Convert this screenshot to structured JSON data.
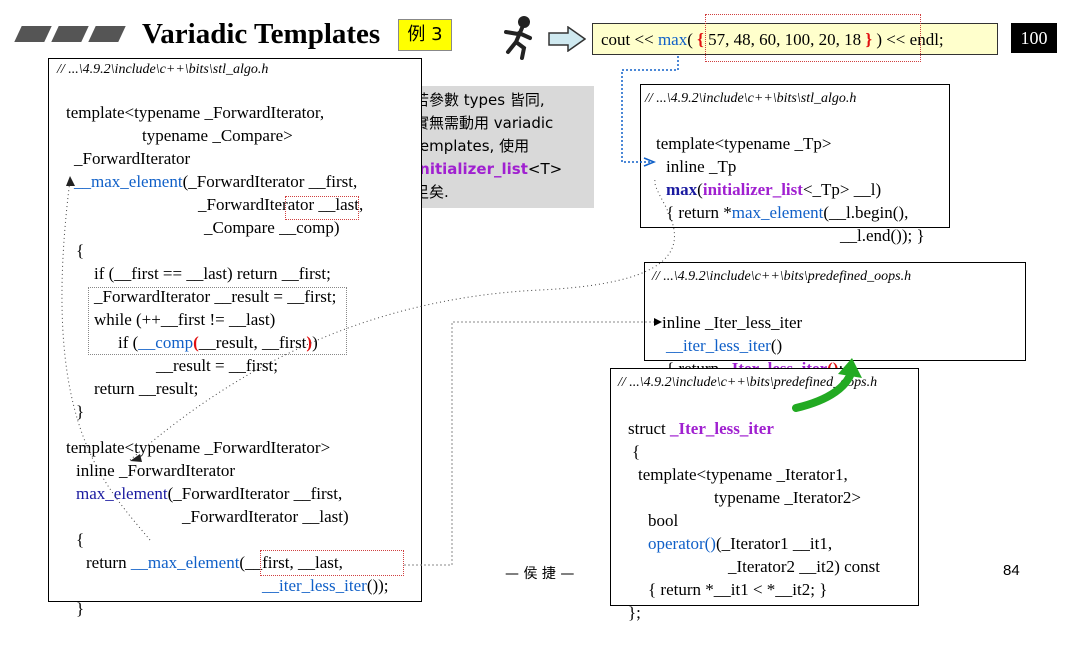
{
  "title": "Variadic Templates",
  "badge": {
    "label": "例 3"
  },
  "top_expr": {
    "prefix": "cout << ",
    "fn": "max",
    "lparen": "( ",
    "lbrace": "{",
    "values": " 57, 48, 60, 100, 20, 18 ",
    "rbrace": "}",
    "suffix": " ) << endl;"
  },
  "result": "100",
  "note": {
    "l1": "若參數 types 皆同,",
    "l2": "實無需動用 variadic",
    "l3": "templates, 使用",
    "l4_kw": "initializer_list",
    "l4_rest": "<T>",
    "l5": "足矣."
  },
  "left_panel": {
    "path": "// ...\\4.9.2\\include\\c++\\bits\\stl_algo.h",
    "lines": {
      "a1": "template<typename _ForwardIterator,",
      "a2": "typename _Compare>",
      "a3": "_ForwardIterator",
      "a4_fn": "__max_element",
      "a4_rest": "(_ForwardIterator __first,",
      "a5": "_ForwardIterator __last,",
      "a6": "_Compare __comp)",
      "a7": "{",
      "a8": "if (__first == __last) return __first;",
      "a9": "_ForwardIterator __result = __first;",
      "a10": "while (++__first != __last)",
      "a11_pre": "if (",
      "a11_fn": "__comp",
      "a11_lp": "(",
      "a11_mid": "__result, __first",
      "a11_rp": ")",
      "a11_end": ")",
      "a12": "__result = __first;",
      "a13": "return __result;",
      "a14": "}",
      "b1": "template<typename _ForwardIterator>",
      "b2": "inline _ForwardIterator",
      "b3_fn": "max_element",
      "b3_rest": "(_ForwardIterator __first,",
      "b4": "_ForwardIterator __last)",
      "b5": "{",
      "b6_pre": "return ",
      "b6_fn": "__max_element",
      "b6_rest": "(__first, __last,",
      "b7_fn": "__iter_less_iter",
      "b7_rest": "());",
      "b8": "}"
    }
  },
  "right_top": {
    "path": "// ...\\4.9.2\\include\\c++\\bits\\stl_algo.h",
    "l1": "template<typename _Tp>",
    "l2": "inline _Tp",
    "l3_fn": "max",
    "l3_lp": "(",
    "l3_kw": "initializer_list",
    "l3_rest": "<_Tp> __l)",
    "l4_pre": "{ return *",
    "l4_fn": "max_element",
    "l4_rest": "(__l.begin(),",
    "l5": "__l.end()); }"
  },
  "right_mid": {
    "path": "// ...\\4.9.2\\include\\c++\\bits\\predefined_oops.h",
    "l1": "inline _Iter_less_iter",
    "l2_fn": "__iter_less_iter",
    "l2_rest": "()",
    "l3_pre": "{ return ",
    "l3_fn": "_Iter_less_iter",
    "l3_paren": "()",
    "l3_rest": "; }"
  },
  "right_bottom": {
    "path": "// ...\\4.9.2\\include\\c++\\bits\\predefined_oops.h",
    "l1_pre": "struct ",
    "l1_fn": "_Iter_less_iter",
    "l2": "{",
    "l3": "template<typename _Iterator1,",
    "l4": "typename _Iterator2>",
    "l5": "bool",
    "l6_fn": "operator()",
    "l6_rest": "(_Iterator1 __it1,",
    "l7": "_Iterator2 __it2) const",
    "l8": "{ return *__it1 < *__it2; }",
    "l9": "};"
  },
  "footer": {
    "author": "— 侯 捷 —",
    "page": "84"
  },
  "colors": {
    "accent_blue": "#1060c8",
    "purple": "#a020d0",
    "red": "#e01010",
    "badge_yellow": "#ffff00",
    "note_gray": "#d9d9d9"
  }
}
